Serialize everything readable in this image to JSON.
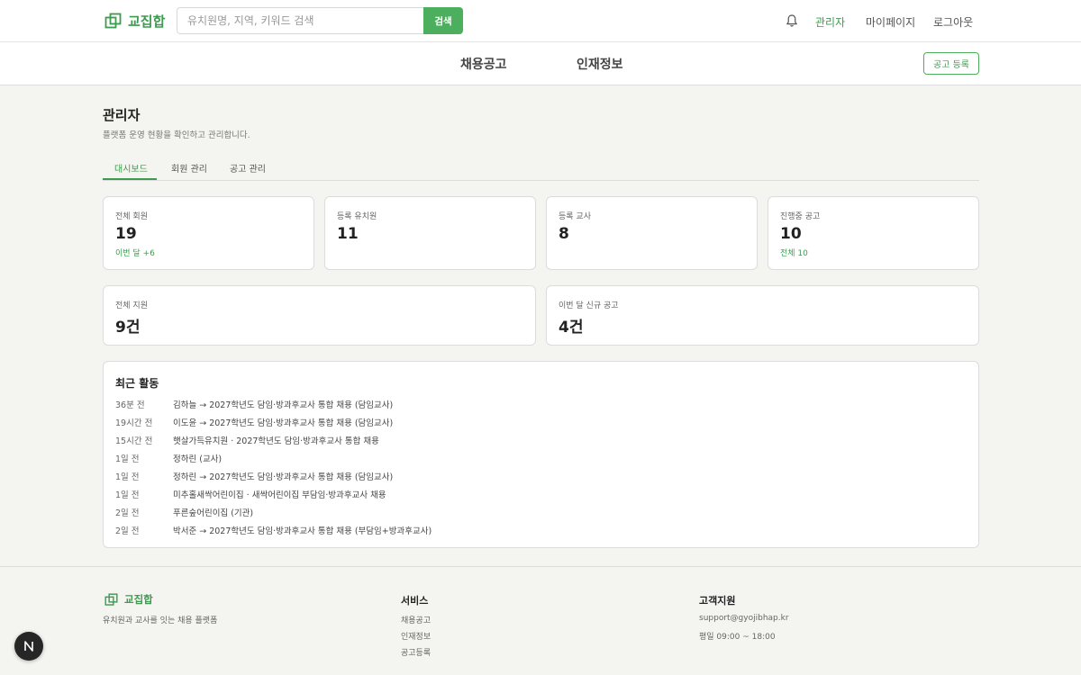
{
  "brand": {
    "name": "교집합",
    "color": "#3d9b4f",
    "icon": "overlap-squares-icon"
  },
  "search": {
    "placeholder": "유치원명, 지역, 키워드 검색",
    "button_label": "검색"
  },
  "header": {
    "bell_icon": "bell-icon",
    "nav": [
      {
        "label": "관리자",
        "active": true
      },
      {
        "label": "마이페이지",
        "active": false
      },
      {
        "label": "로그아웃",
        "active": false
      }
    ]
  },
  "subnav": {
    "items": [
      {
        "label": "채용공고"
      },
      {
        "label": "인재정보"
      }
    ],
    "post_button": "공고 등록"
  },
  "page": {
    "title": "관리자",
    "subtitle": "플랫폼 운영 현황을 확인하고 관리합니다."
  },
  "tabs": [
    {
      "label": "대시보드",
      "active": true
    },
    {
      "label": "회원 관리",
      "active": false
    },
    {
      "label": "공고 관리",
      "active": false
    }
  ],
  "stats": [
    {
      "label": "전체 회원",
      "value": "19",
      "delta": "이번 달 +6"
    },
    {
      "label": "등록 유치원",
      "value": "11",
      "delta": ""
    },
    {
      "label": "등록 교사",
      "value": "8",
      "delta": ""
    },
    {
      "label": "진행중 공고",
      "value": "10",
      "delta": "전체 10"
    }
  ],
  "stats_wide": [
    {
      "label": "전체 지원",
      "value": "9건"
    },
    {
      "label": "이번 달 신규 공고",
      "value": "4건"
    }
  ],
  "activity": {
    "title": "최근 활동",
    "items": [
      {
        "time": "36분 전",
        "text": "김하늘 → 2027학년도 담임·방과후교사 통합 채용 (담임교사)"
      },
      {
        "time": "19시간 전",
        "text": "이도윤 → 2027학년도 담임·방과후교사 통합 채용 (담임교사)"
      },
      {
        "time": "15시간 전",
        "text": "햇살가득유치원 · 2027학년도 담임·방과후교사 통합 채용"
      },
      {
        "time": "1일 전",
        "text": "정하린 (교사)"
      },
      {
        "time": "1일 전",
        "text": "정하린 → 2027학년도 담임·방과후교사 통합 채용 (담임교사)"
      },
      {
        "time": "1일 전",
        "text": "미추홀새싹어린이집 · 새싹어린이집 부담임·방과후교사 채용"
      },
      {
        "time": "2일 전",
        "text": "푸른숲어린이집 (기관)"
      },
      {
        "time": "2일 전",
        "text": "박서준 → 2027학년도 담임·방과후교사 통합 채용 (부담임+방과후교사)"
      }
    ]
  },
  "footer": {
    "brand": "교집합",
    "tagline": "유치원과 교사를 잇는 채용 플랫폼",
    "service_title": "서비스",
    "service_links": [
      "채용공고",
      "인재정보",
      "공고등록"
    ],
    "support_title": "고객지원",
    "support_email": "support@gyojibhap.kr",
    "support_hours": "평일 09:00 ~ 18:00"
  },
  "dev_badge": {
    "label": "N"
  }
}
